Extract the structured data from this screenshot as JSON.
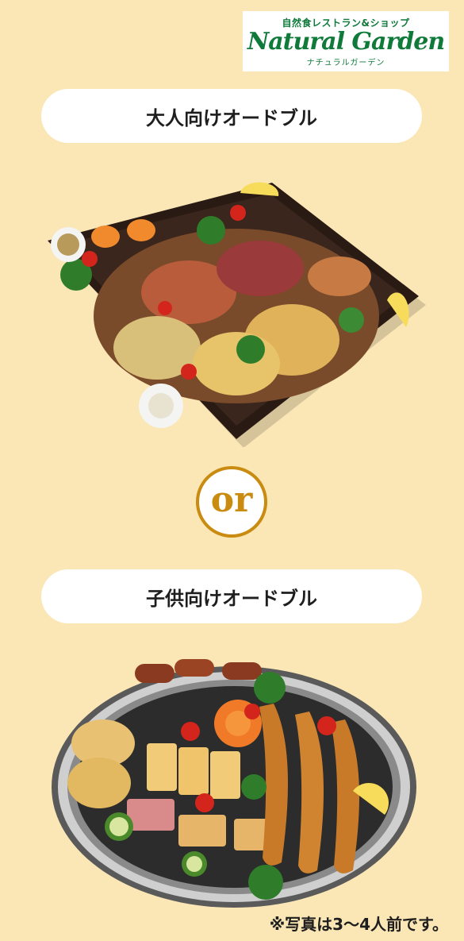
{
  "logo": {
    "kicker": "自然食レストラン&ショップ",
    "brand": "Natural Garden",
    "kana": "ナチュラルガーデン",
    "color": "#0f7a3a"
  },
  "sections": {
    "adult_title": "大人向けオードブル",
    "or_label": "or",
    "kids_title": "子供向けオードブル"
  },
  "footnote": "※写真は3〜4人前です。",
  "colors": {
    "background": "#FBE6B5",
    "accent": "#c98b10",
    "pill": "#ffffff"
  }
}
